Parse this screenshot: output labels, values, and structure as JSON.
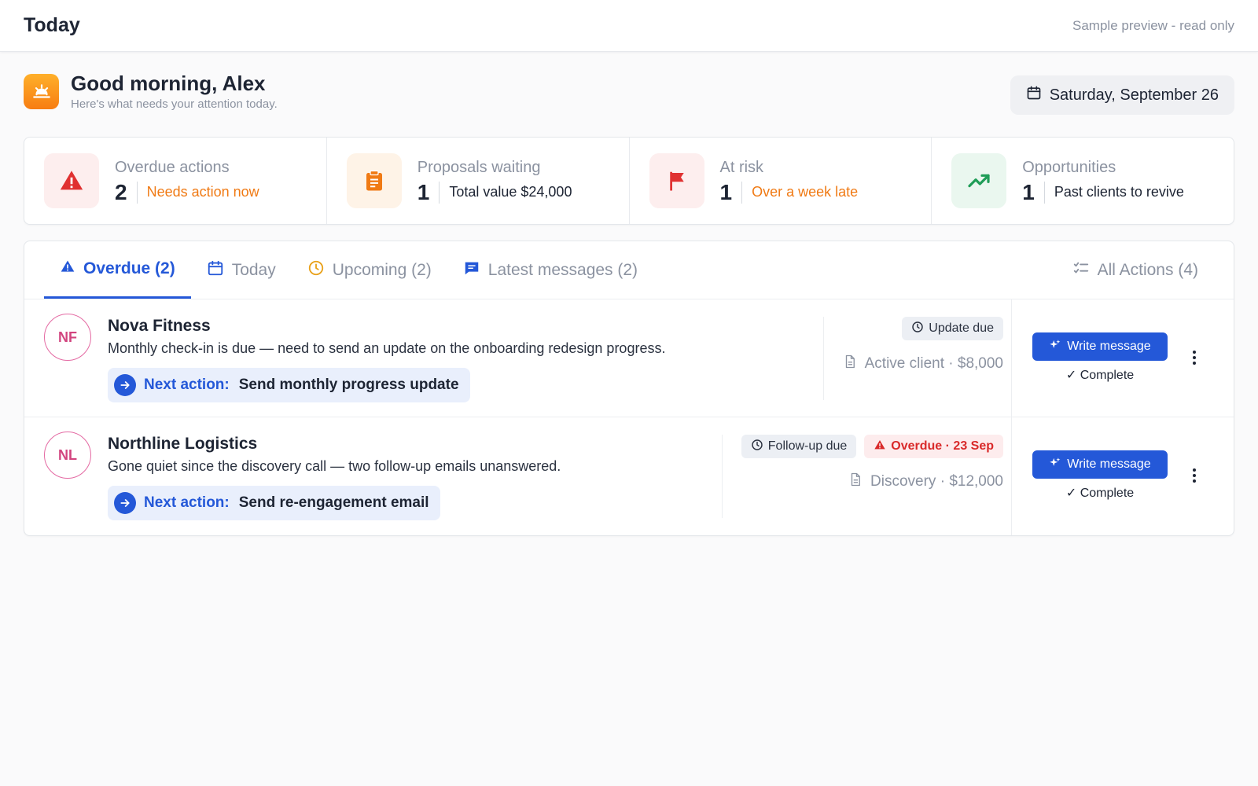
{
  "topbar": {
    "title": "Today",
    "readonly": "Sample preview - read only"
  },
  "greeting": {
    "title": "Good morning, Alex",
    "subtitle": "Here's what needs your attention today.",
    "date": "Saturday, September 26"
  },
  "stats": [
    {
      "label": "Overdue actions",
      "value": "2",
      "desc": "Needs action now",
      "desc_color": "#f07a14",
      "icon": "warning-triangle-icon",
      "color": "#e03131",
      "bg": "#fdeeee"
    },
    {
      "label": "Proposals waiting",
      "value": "1",
      "desc": "Total value $24,000",
      "desc_color": "#1d2433",
      "icon": "clipboard-icon",
      "color": "#f07a14",
      "bg": "#fef3e7"
    },
    {
      "label": "At risk",
      "value": "1",
      "desc": "Over a week late",
      "desc_color": "#f07a14",
      "icon": "flag-icon",
      "color": "#e03131",
      "bg": "#fdeeee"
    },
    {
      "label": "Opportunities",
      "value": "1",
      "desc": "Past clients to revive",
      "desc_color": "#1d2433",
      "icon": "trending-up-icon",
      "color": "#1f9d57",
      "bg": "#eaf7ef"
    }
  ],
  "tabs": [
    {
      "label": "Overdue (2)",
      "icon": "warning-triangle-icon",
      "active": true
    },
    {
      "label": "Today",
      "icon": "calendar-icon",
      "active": false
    },
    {
      "label": "Upcoming (2)",
      "icon": "clock-icon",
      "active": false
    },
    {
      "label": "Latest messages (2)",
      "icon": "chat-icon",
      "active": false
    }
  ],
  "all_actions_label": "All Actions (4)",
  "rows": [
    {
      "initials": "NF",
      "name": "Nova Fitness",
      "desc": "Monthly check-in is due — need to send an update on the onboarding redesign progress.",
      "next_label": "Next action:",
      "next_value": "Send monthly progress update",
      "badge_gray": "Update due",
      "meta": "Active client · $8,000",
      "write_label": "Write message",
      "complete_label": "Complete"
    },
    {
      "initials": "NL",
      "name": "Northline Logistics",
      "desc": "Gone quiet since the discovery call — two follow-up emails unanswered.",
      "next_label": "Next action:",
      "next_value": "Send re-engagement email",
      "badge_gray": "Follow-up due",
      "badge_red": "Overdue · 23 Sep",
      "meta": "Discovery · $12,000",
      "write_label": "Write message",
      "complete_label": "Complete"
    }
  ]
}
